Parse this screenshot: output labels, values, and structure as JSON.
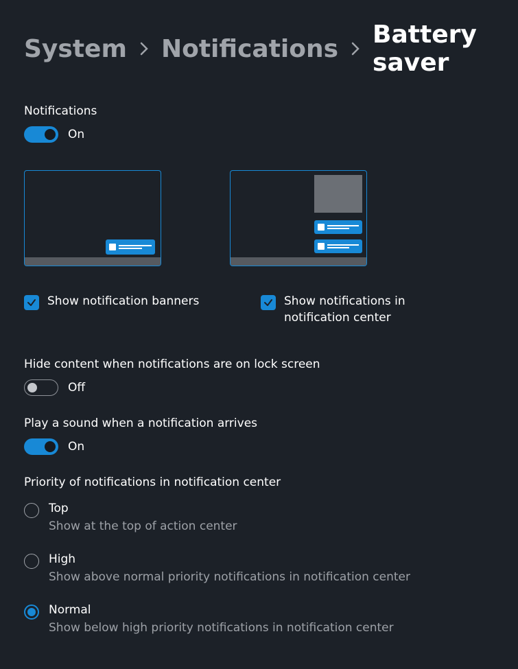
{
  "breadcrumb": {
    "item1": "System",
    "item2": "Notifications",
    "item3": "Battery saver"
  },
  "notifications": {
    "label": "Notifications",
    "state_label": "On"
  },
  "checkboxes": {
    "banners": {
      "label": "Show notification banners"
    },
    "center": {
      "label": "Show notifications in notification center"
    }
  },
  "hide_content": {
    "label": "Hide content when notifications are on lock screen",
    "state_label": "Off"
  },
  "play_sound": {
    "label": "Play a sound when a notification arrives",
    "state_label": "On"
  },
  "priority": {
    "label": "Priority of notifications in notification center",
    "options": [
      {
        "title": "Top",
        "desc": "Show at the top of action center"
      },
      {
        "title": "High",
        "desc": "Show above normal priority notifications in notification center"
      },
      {
        "title": "Normal",
        "desc": "Show below high priority notifications in notification center"
      }
    ]
  }
}
